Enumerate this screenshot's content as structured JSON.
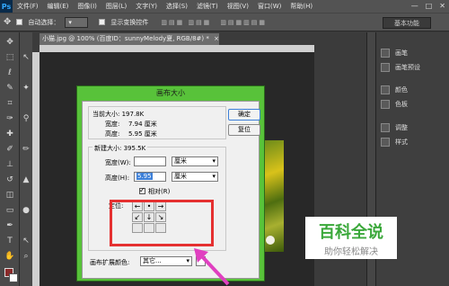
{
  "menubar": {
    "logo": "Ps",
    "items": [
      "文件(F)",
      "编辑(E)",
      "图像(I)",
      "图层(L)",
      "文字(Y)",
      "选择(S)",
      "滤镜(T)",
      "视图(V)",
      "窗口(W)",
      "帮助(H)"
    ],
    "win_min": "—",
    "win_max": "□",
    "win_close": "✕"
  },
  "options": {
    "auto_select_label": "自动选择：",
    "auto_select_value": "",
    "transform_label": "显示变换控件",
    "workspace": "基本功能"
  },
  "document": {
    "tab_title": "小猫.jpg @ 100% (百度ID：sunnyMelody夏, RGB/8#) *",
    "tab_close": "×"
  },
  "panels": {
    "items": [
      "画笔",
      "画笔预设",
      "颜色",
      "色板",
      "调整",
      "样式"
    ]
  },
  "dialog": {
    "title": "画布大小",
    "current": {
      "legend": "",
      "size_label": "当前大小: 197.8K",
      "width_label": "宽度:",
      "width_value": "7.94 厘米",
      "height_label": "高度:",
      "height_value": "5.95 厘米"
    },
    "new": {
      "legend": "新建大小: 395.5K",
      "width_label": "宽度(W):",
      "width_value": "",
      "width_unit": "厘米",
      "height_label": "高度(H):",
      "height_value": "5.95",
      "height_unit": "厘米",
      "relative_label": "相对(R)",
      "anchor_label": "定位:",
      "anchor_cells": [
        "←",
        "•",
        "→",
        "↙",
        "↓",
        "↘",
        "",
        "",
        ""
      ]
    },
    "ok_label": "确定",
    "reset_label": "复位",
    "ext_color_label": "画布扩展颜色:",
    "ext_color_value": "其它..."
  },
  "watermark": {
    "main": "百科全说",
    "sub": "助你轻松解决"
  },
  "colors": {
    "dialog_frame": "#58c23a",
    "highlight": "#e53030",
    "arrow": "#e040c0",
    "watermark_main": "#3aa83a",
    "watermark_sub": "#888888"
  }
}
